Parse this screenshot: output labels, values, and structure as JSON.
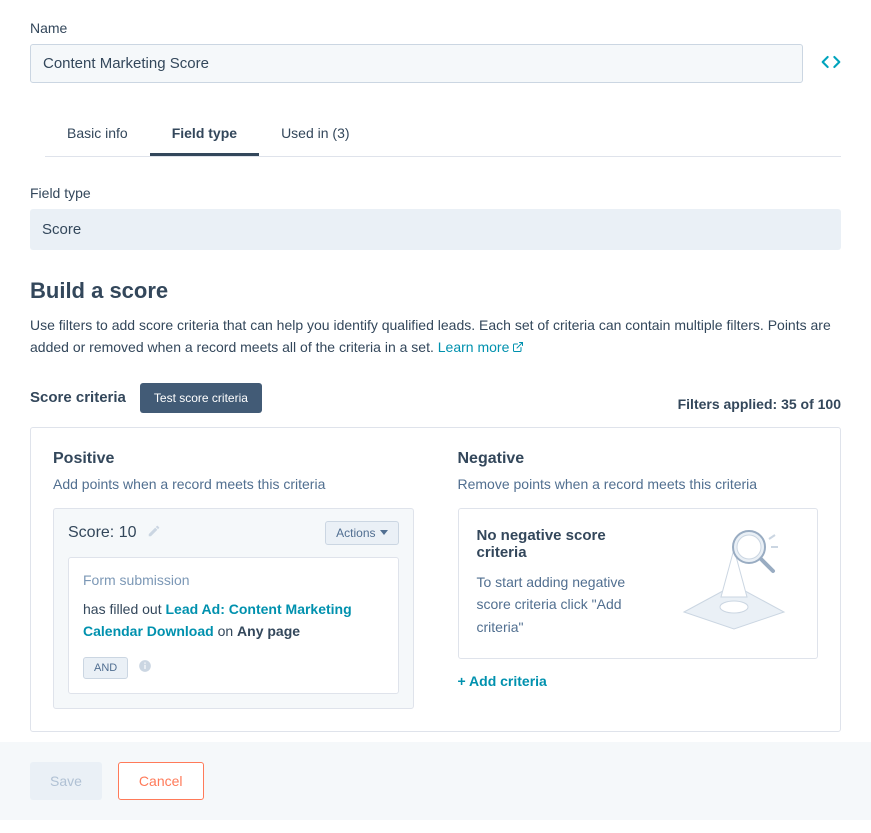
{
  "name": {
    "label": "Name",
    "value": "Content Marketing Score"
  },
  "tabs": [
    {
      "label": "Basic info"
    },
    {
      "label": "Field type"
    },
    {
      "label": "Used in (3)"
    }
  ],
  "fieldType": {
    "label": "Field type",
    "value": "Score"
  },
  "build": {
    "heading": "Build a score",
    "description": "Use filters to add score criteria that can help you identify qualified leads. Each set of criteria can contain multiple filters. Points are added or removed when a record meets all of the criteria in a set. ",
    "learnMore": "Learn more"
  },
  "criteria": {
    "heading": "Score criteria",
    "testButton": "Test score criteria",
    "filtersApplied": "Filters applied: 35 of 100"
  },
  "positive": {
    "heading": "Positive",
    "sub": "Add points when a record meets this criteria",
    "scoreLabel": "Score: 10",
    "actions": "Actions",
    "ruleTitle": "Form submission",
    "rulePre": "has filled out ",
    "ruleForm": "Lead Ad: Content Marketing Calendar Download",
    "ruleMid": " on ",
    "rulePage": "Any page",
    "and": "AND"
  },
  "negative": {
    "heading": "Negative",
    "sub": "Remove points when a record meets this criteria",
    "emptyTitle": "No negative score criteria",
    "emptyDesc": "To start adding negative score criteria click \"Add criteria\"",
    "add": "+ Add criteria"
  },
  "footer": {
    "save": "Save",
    "cancel": "Cancel"
  }
}
